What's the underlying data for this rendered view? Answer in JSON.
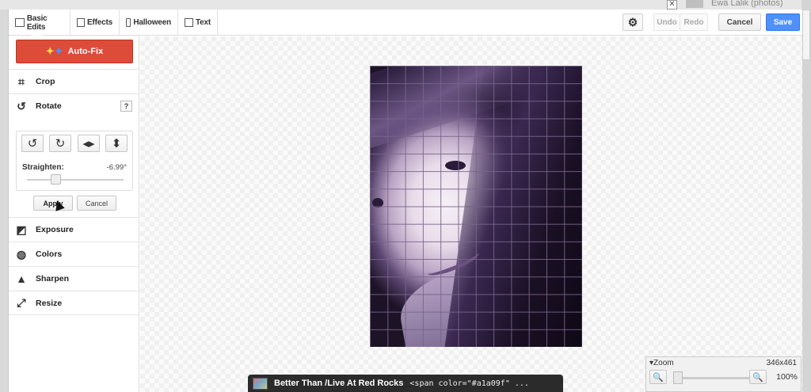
{
  "background": {
    "close_glyph": "✕",
    "user_label": "Ewa Lalik (photos)"
  },
  "toolbar": {
    "tabs": [
      {
        "label": "Basic Edits",
        "icon": "image-icon",
        "active": true
      },
      {
        "label": "Effects",
        "icon": "effects-icon",
        "active": false
      },
      {
        "label": "Halloween",
        "icon": "paint-roller-icon",
        "active": false
      },
      {
        "label": "Text",
        "icon": "text-icon",
        "active": false
      }
    ],
    "settings_icon": "gear-icon",
    "undo_label": "Undo",
    "redo_label": "Redo",
    "cancel_label": "Cancel",
    "save_label": "Save"
  },
  "panel": {
    "autofix_label": "Auto-Fix",
    "items": [
      {
        "label": "Crop",
        "icon": "crop-icon"
      },
      {
        "label": "Rotate",
        "icon": "rotate-icon"
      },
      {
        "label": "Exposure",
        "icon": "exposure-icon"
      },
      {
        "label": "Colors",
        "icon": "palette-icon"
      },
      {
        "label": "Sharpen",
        "icon": "sharpen-icon"
      },
      {
        "label": "Resize",
        "icon": "resize-icon"
      }
    ],
    "help_label": "?",
    "rotate": {
      "straighten_label": "Straighten:",
      "straighten_value": "-6.99°",
      "straighten_fraction": 0.25,
      "apply_label": "Apply",
      "cancel_label": "Cancel"
    }
  },
  "zoom": {
    "label": "Zoom",
    "image_size": "346x461",
    "percent": "100%",
    "level_fraction": 0.0
  },
  "now_playing": {
    "title": "Better Than /Live At Red Rocks",
    "extra": "<span color=\"#a1a09f\" ..."
  },
  "colors": {
    "accent": "#4d90fe",
    "autofix": "#dd4b39",
    "photo_tint": "#5a4570"
  }
}
